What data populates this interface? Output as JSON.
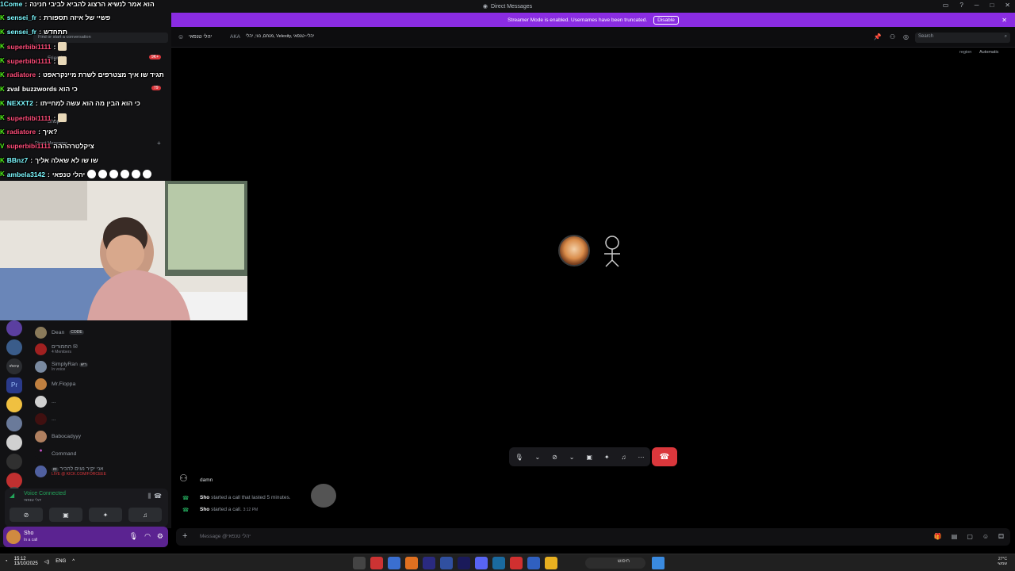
{
  "window": {
    "title": "Direct Messages",
    "top_left_label": "1Come"
  },
  "banner": {
    "text": "Streamer Mode is enabled. Usernames have been truncated.",
    "button": "Disable"
  },
  "sidebar": {
    "search_placeholder": "Find or start a conversation",
    "friends": "Friends",
    "shop": "Shop",
    "direct_messages": "Direct Messages",
    "dms": [
      {
        "name": "Dean",
        "tag": "CODE",
        "sub": ""
      },
      {
        "name": "החמורים",
        "sub": "4 Members"
      },
      {
        "name": "SimplyRan",
        "tag": "ריא",
        "sub": "In voice"
      },
      {
        "name": "Mr.Floppa",
        "sub": ""
      },
      {
        "name": "...",
        "sub": ""
      },
      {
        "name": "...",
        "sub": ""
      },
      {
        "name": "Babocadyyy",
        "sub": ""
      },
      {
        "name": "Command",
        "sub": ""
      },
      {
        "name": "אני יקיר נעים להכיר",
        "tag": "סו",
        "sub": "LIVE @ KICK.COM/FORCEEE"
      }
    ],
    "badges": {
      "mentions": "9K+",
      "other": "79"
    }
  },
  "voice": {
    "status": "Voice Connected",
    "channel": "יהלי טנפאי"
  },
  "user": {
    "name": "Sho",
    "status": "In a call"
  },
  "header": {
    "name": "יהלי טנפאי",
    "aka_label": "AKA",
    "aka_names": "מנחם, נעי, יהלי, Velexity, יהלי~טנפאי",
    "search_placeholder": "Search",
    "region_label": "region",
    "region_value": "Automatic"
  },
  "messages": [
    {
      "author": "Sho",
      "text": "damn"
    },
    {
      "author": "Sho",
      "text": "started a call that lasted 5 minutes."
    },
    {
      "author": "Sho",
      "text": "started a call.",
      "time": "3:12 PM"
    }
  ],
  "composer": {
    "placeholder": "Message @יהלי טנפאי"
  },
  "overlay_chat": [
    {
      "user": "1Come",
      "text": "הוא אמר לנשיא הרצוג להביא לביבי חנינה"
    },
    {
      "user": "sensei_fr",
      "text": "פשיי של איזה תספורת"
    },
    {
      "user": "sensei_fr",
      "text": "תתחדש"
    },
    {
      "user": "superbibi1111",
      "text": ""
    },
    {
      "user": "superbibi1111",
      "text": ""
    },
    {
      "user": "radiatore",
      "text": "תגיד שו איך מצטרפים לשרת מיינקראפט"
    },
    {
      "user": "zval",
      "text": "buzzwords כי הוא"
    },
    {
      "user": "NEXXT2",
      "text": "כי הוא הבין מה הוא עשה למחייתו"
    },
    {
      "user": "superbibi1111",
      "text": ""
    },
    {
      "user": "radiatore",
      "text": "איך?"
    },
    {
      "user": "superbibi1111",
      "text": "ציקלטרהההה"
    },
    {
      "user": "BBnz7",
      "text": "שו שו לא שאלה אליך"
    },
    {
      "user": "ambela3142",
      "text": "יהלי טנפאי"
    }
  ],
  "taskbar": {
    "time": "15:12",
    "date": "13/10/2025",
    "lang": "ENG",
    "search": "חיפוש",
    "temp": "27°C",
    "weather": "שמשי"
  }
}
